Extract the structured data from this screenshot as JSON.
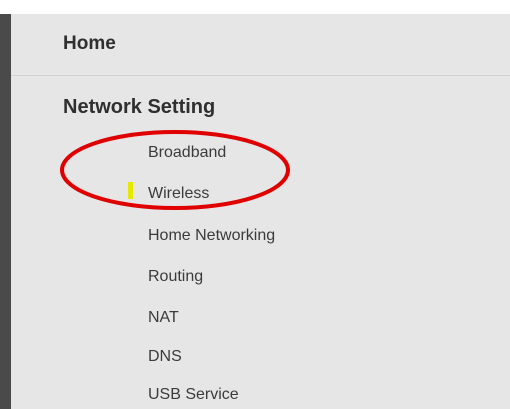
{
  "sidebar": {
    "home_label": "Home",
    "section_title": "Network Setting",
    "items": [
      {
        "label": "Broadband"
      },
      {
        "label": "Wireless"
      },
      {
        "label": "Home Networking"
      },
      {
        "label": "Routing"
      },
      {
        "label": "NAT"
      },
      {
        "label": "DNS"
      },
      {
        "label": "USB Service"
      }
    ],
    "active_item": "Wireless"
  },
  "colors": {
    "sidebar_bg": "#e6e6e6",
    "active_marker": "#e5e800",
    "annotation": "#e00000"
  }
}
